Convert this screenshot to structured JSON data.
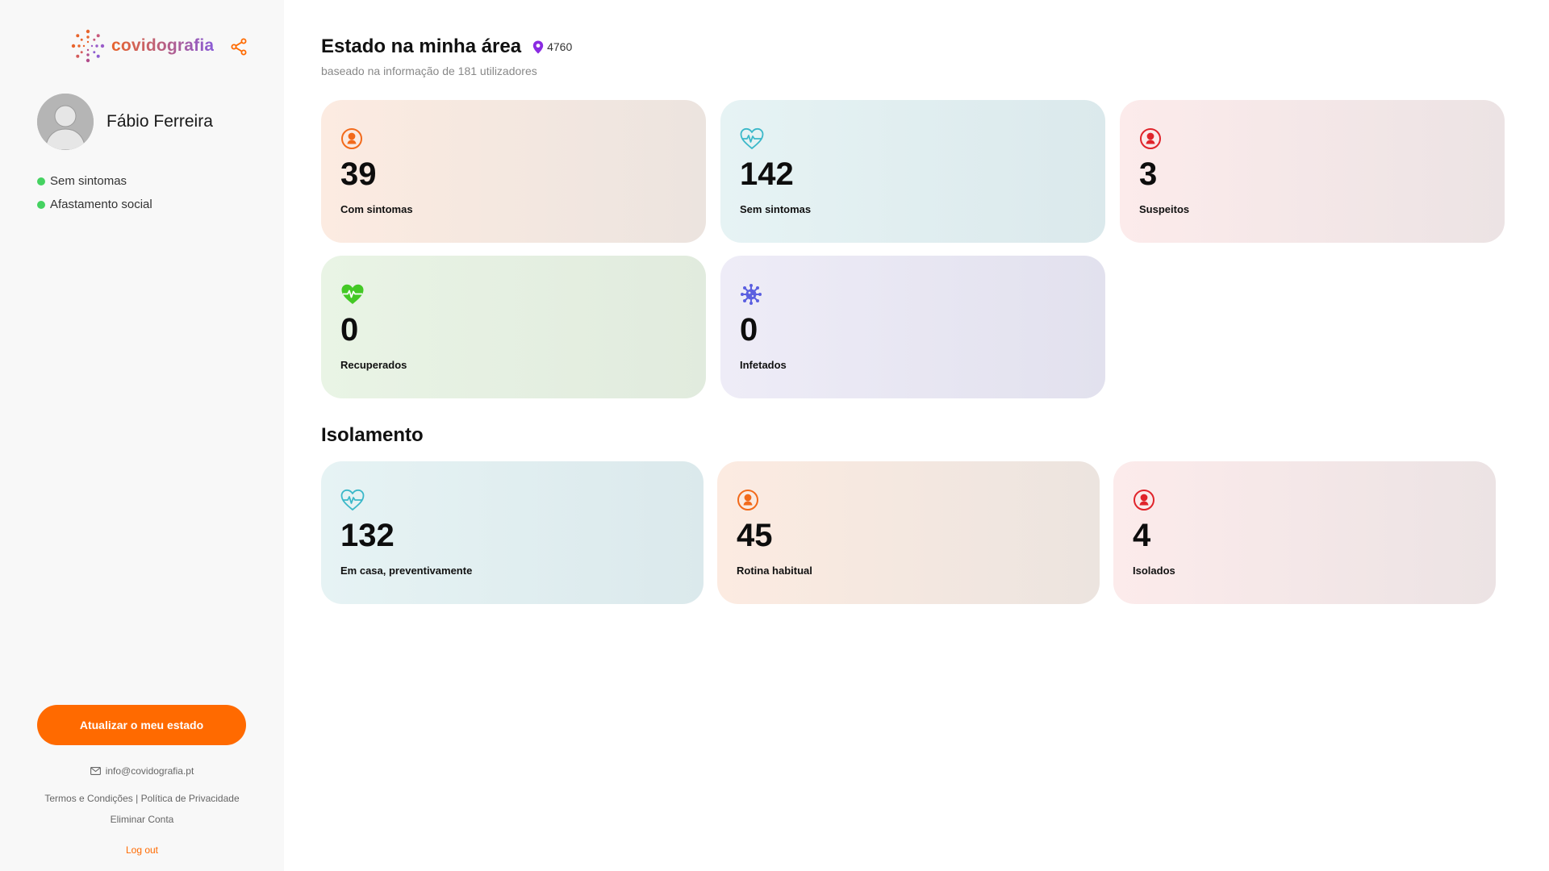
{
  "brand": {
    "name": "covidografia",
    "logo_icon": "virus-dots-logo-icon",
    "share_icon": "share-icon"
  },
  "colors": {
    "accent": "#ff6a00",
    "status_ok": "#45d261",
    "sidebar_bg": "#f8f8f8",
    "brand_purple": "#7a5fd0",
    "pin_purple": "#8a2be2"
  },
  "profile": {
    "name": "Fábio Ferreira",
    "avatar_icon": "user-avatar-icon"
  },
  "status": [
    {
      "label": "Sem sintomas"
    },
    {
      "label": "Afastamento social"
    }
  ],
  "update_button": "Atualizar o meu estado",
  "footer": {
    "email": "info@covidografia.pt",
    "terms": "Termos e Condições",
    "separator": "|",
    "privacy": "Política de Privacidade",
    "delete": "Eliminar Conta",
    "logout": "Log out"
  },
  "area": {
    "title": "Estado na minha área",
    "postal_code": "4760",
    "subtitle": "baseado na informação de 181 utilizadores",
    "cards": [
      {
        "value": "39",
        "label": "Com sintomas",
        "icon": "person-circle-icon",
        "color": "#f26a1b"
      },
      {
        "value": "142",
        "label": "Sem sintomas",
        "icon": "heart-pulse-outline-icon",
        "color": "#3bb8c9"
      },
      {
        "value": "3",
        "label": "Suspeitos",
        "icon": "person-circle-icon",
        "color": "#e0242b"
      },
      {
        "value": "0",
        "label": "Recuperados",
        "icon": "heart-pulse-filled-icon",
        "color": "#43c925"
      },
      {
        "value": "0",
        "label": "Infetados",
        "icon": "virus-icon",
        "color": "#5b5fe0"
      }
    ]
  },
  "isolation": {
    "title": "Isolamento",
    "cards": [
      {
        "value": "132",
        "label": "Em casa, preventivamente",
        "icon": "heart-pulse-outline-icon",
        "color": "#3bb8c9"
      },
      {
        "value": "45",
        "label": "Rotina habitual",
        "icon": "person-circle-icon",
        "color": "#f26a1b"
      },
      {
        "value": "4",
        "label": "Isolados",
        "icon": "person-circle-icon",
        "color": "#e0242b"
      }
    ]
  }
}
